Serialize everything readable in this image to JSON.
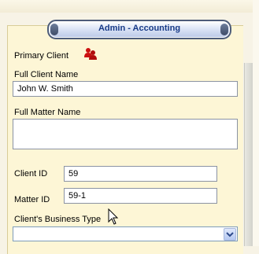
{
  "header": {
    "title": "Admin - Accounting"
  },
  "primary_client": {
    "label": "Primary Client",
    "icon": "user-group-icon"
  },
  "full_client_name": {
    "label": "Full Client Name",
    "value": "John W. Smith"
  },
  "full_matter_name": {
    "label": "Full Matter Name",
    "value": ""
  },
  "client_id": {
    "label": "Client ID",
    "value": "59"
  },
  "matter_id": {
    "label": "Matter ID",
    "value": "59-1"
  },
  "business_type": {
    "label": "Client's Business Type",
    "value": ""
  },
  "colors": {
    "panel_bg": "#fdf6d6",
    "header_text": "#173a87",
    "user_icon": "#cc1111"
  }
}
